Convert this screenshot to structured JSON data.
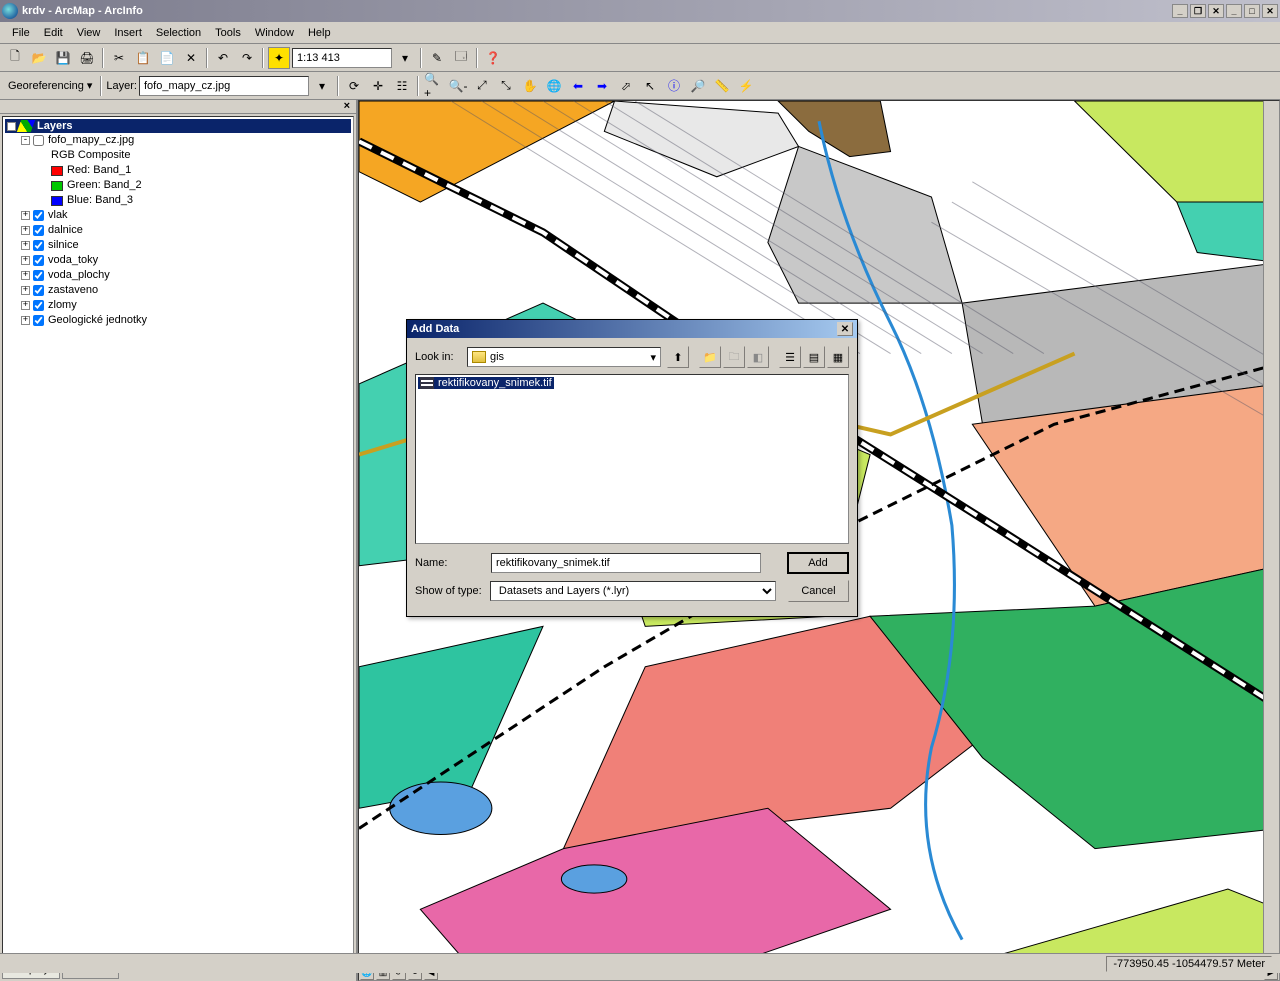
{
  "title": "krdv - ArcMap - ArcInfo",
  "menu": [
    "File",
    "Edit",
    "View",
    "Insert",
    "Selection",
    "Tools",
    "Window",
    "Help"
  ],
  "scale": "1:13 413",
  "georef": {
    "label": "Georeferencing",
    "layer_label": "Layer:",
    "layer_value": "fofo_mapy_cz.jpg"
  },
  "toc": {
    "header": "Layers",
    "raster": {
      "name": "fofo_mapy_cz.jpg",
      "composite": "RGB Composite",
      "bands": [
        {
          "color": "#ff0000",
          "label": "Red:   Band_1"
        },
        {
          "color": "#00c800",
          "label": "Green: Band_2"
        },
        {
          "color": "#0000ff",
          "label": "Blue:  Band_3"
        }
      ]
    },
    "layers": [
      "vlak",
      "dalnice",
      "silnice",
      "voda_toky",
      "voda_plochy",
      "zastaveno",
      "zlomy",
      "Geologické jednotky"
    ],
    "tabs": {
      "display": "Display",
      "source": "Source"
    }
  },
  "dialog": {
    "title": "Add Data",
    "lookin_label": "Look in:",
    "lookin_value": "gis",
    "file_selected": "rektifikovany_snimek.tif",
    "name_label": "Name:",
    "name_value": "rektifikovany_snimek.tif",
    "type_label": "Show of type:",
    "type_value": "Datasets and Layers (*.lyr)",
    "add": "Add",
    "cancel": "Cancel"
  },
  "status": {
    "coords": "-773950.45  -1054479.57 Meter"
  }
}
